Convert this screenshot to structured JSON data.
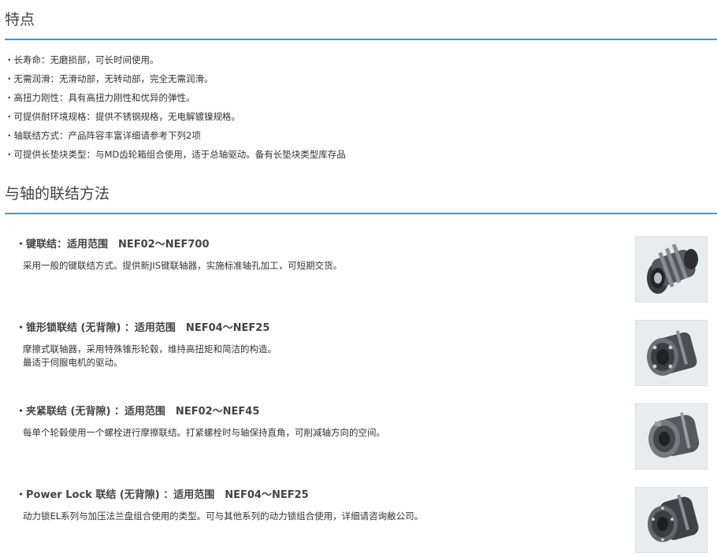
{
  "section_features": {
    "title": "特点",
    "items": [
      "・长寿命：无磨损部，可长时间使用。",
      "・无需润滑：无滑动部，无转动部，完全无需润滑。",
      "・高扭力刚性：具有高扭力刚性和优异的弹性。",
      "・可提供耐环境规格：提供不锈钢规格，无电解镀镍规格。",
      "・轴联结方式：产品阵容丰富详细请参考下列2项",
      "・可提供长垫块类型：与MD齿轮箱组合使用，适于总轴驱动。备有长垫块类型库存品"
    ]
  },
  "section_methods": {
    "title": "与轴的联结方法",
    "items": [
      {
        "title": "・键联结：适用范围　NEF02～NEF700",
        "lines": [
          "采用一般的键联结方式。提供新JIS键联轴器，实施标准轴孔加工，可短期交货。"
        ],
        "image_icon": "key-coupling-photo"
      },
      {
        "title": "・锥形锁联结 (无背隙) ：适用范围　NEF04～NEF25",
        "lines": [
          "摩擦式联轴器，采用特殊锥形轮毂，维持高扭矩和简洁的构造。",
          "最适于伺服电机的驱动。"
        ],
        "image_icon": "taper-lock-coupling-photo"
      },
      {
        "title": "・夹紧联结 (无背隙) ：适用范围　NEF02～NEF45",
        "lines": [
          "每单个轮毂使用一个螺栓进行摩擦联结。打紧螺栓时与轴保持直角，可削减轴方向的空间。"
        ],
        "image_icon": "clamp-coupling-photo"
      },
      {
        "title": "・Power Lock 联结 (无背隙) ：适用范围　NEF04～NEF25",
        "lines": [
          "动力锁EL系列与加压法兰盘组合使用的类型。可与其他系列的动力锁组合使用，详细请咨询敝公司。"
        ],
        "image_icon": "power-lock-coupling-photo"
      }
    ]
  },
  "colors": {
    "accent_rule": "#3a9ad9",
    "text": "#333333"
  }
}
